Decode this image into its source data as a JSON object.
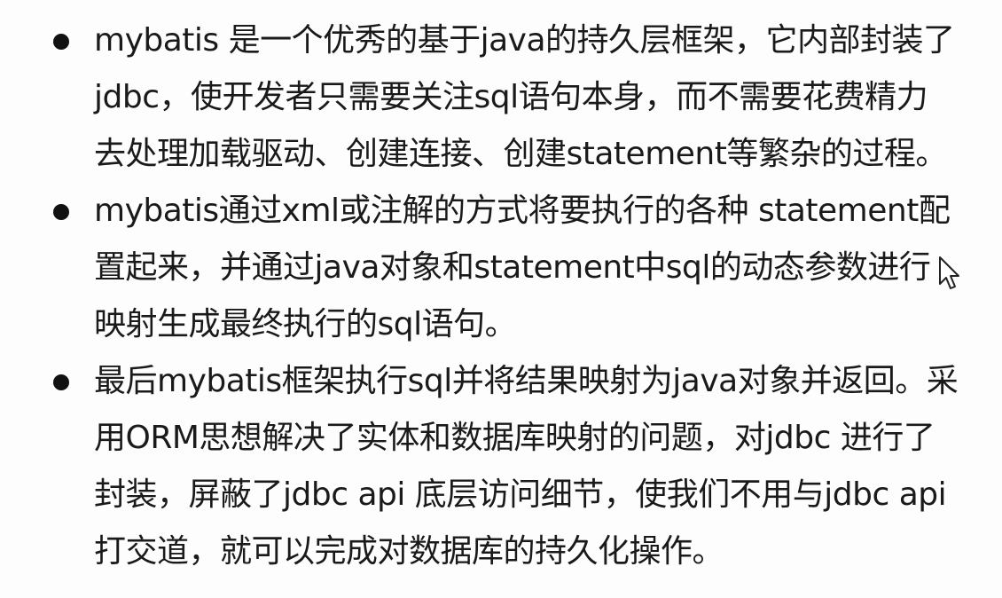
{
  "bullets": [
    {
      "lines": [
        "mybatis 是一个优秀的基于java的持久层框架，它内部封装了",
        "jdbc，使开发者只需要关注sql语句本身，而不需要花费精力",
        "去处理加载驱动、创建连接、创建statement等繁杂的过程。"
      ]
    },
    {
      "lines": [
        "mybatis通过xml或注解的方式将要执行的各种 statement配",
        "置起来，并通过java对象和statement中sql的动态参数进行",
        "映射生成最终执行的sql语句。"
      ]
    },
    {
      "lines": [
        "最后mybatis框架执行sql并将结果映射为java对象并返回。采",
        "用ORM思想解决了实体和数据库映射的问题，对jdbc 进行了",
        "封装，屏蔽了jdbc api 底层访问细节，使我们不用与jdbc api",
        "打交道，就可以完成对数据库的持久化操作。"
      ]
    }
  ],
  "icons": {
    "bullet": "bullet-dot-icon",
    "cursor": "mouse-pointer-icon"
  },
  "colors": {
    "text": "#1a1a1a",
    "background": "#fdfdfd"
  }
}
